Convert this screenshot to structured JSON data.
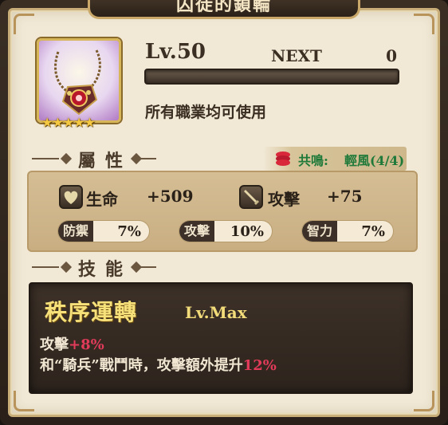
{
  "title": "囚徒的鎖輪",
  "item": {
    "icon": "necklace-icon",
    "stars": "★★★★★",
    "level": "Lv.50",
    "next_label": "NEXT",
    "next_value": "0",
    "exp_fraction": 0.0,
    "usable": "所有職業均可使用"
  },
  "attributes": {
    "header": "屬性",
    "resonance": {
      "icon": "resonance-icon",
      "label": "共鳴:",
      "value": "輕風(4/4)",
      "color": "#1f7a3a"
    },
    "main": [
      {
        "icon": "heart-icon",
        "name": "生命",
        "value": "+509"
      },
      {
        "icon": "sword-icon",
        "name": "攻擊",
        "value": "+75"
      }
    ],
    "sub": [
      {
        "name": "防禦",
        "value": "7%"
      },
      {
        "name": "攻擊",
        "value": "10%"
      },
      {
        "name": "智力",
        "value": "7%"
      }
    ]
  },
  "skill": {
    "header": "技能",
    "name": "秩序運轉",
    "level": "Lv.Max",
    "line1_prefix": "攻擊",
    "line1_value": "+8%",
    "line2_prefix": "和“騎兵”戰鬥時，攻擊額外提升",
    "line2_value": "12%",
    "highlight_color": "#e23b5a"
  }
}
